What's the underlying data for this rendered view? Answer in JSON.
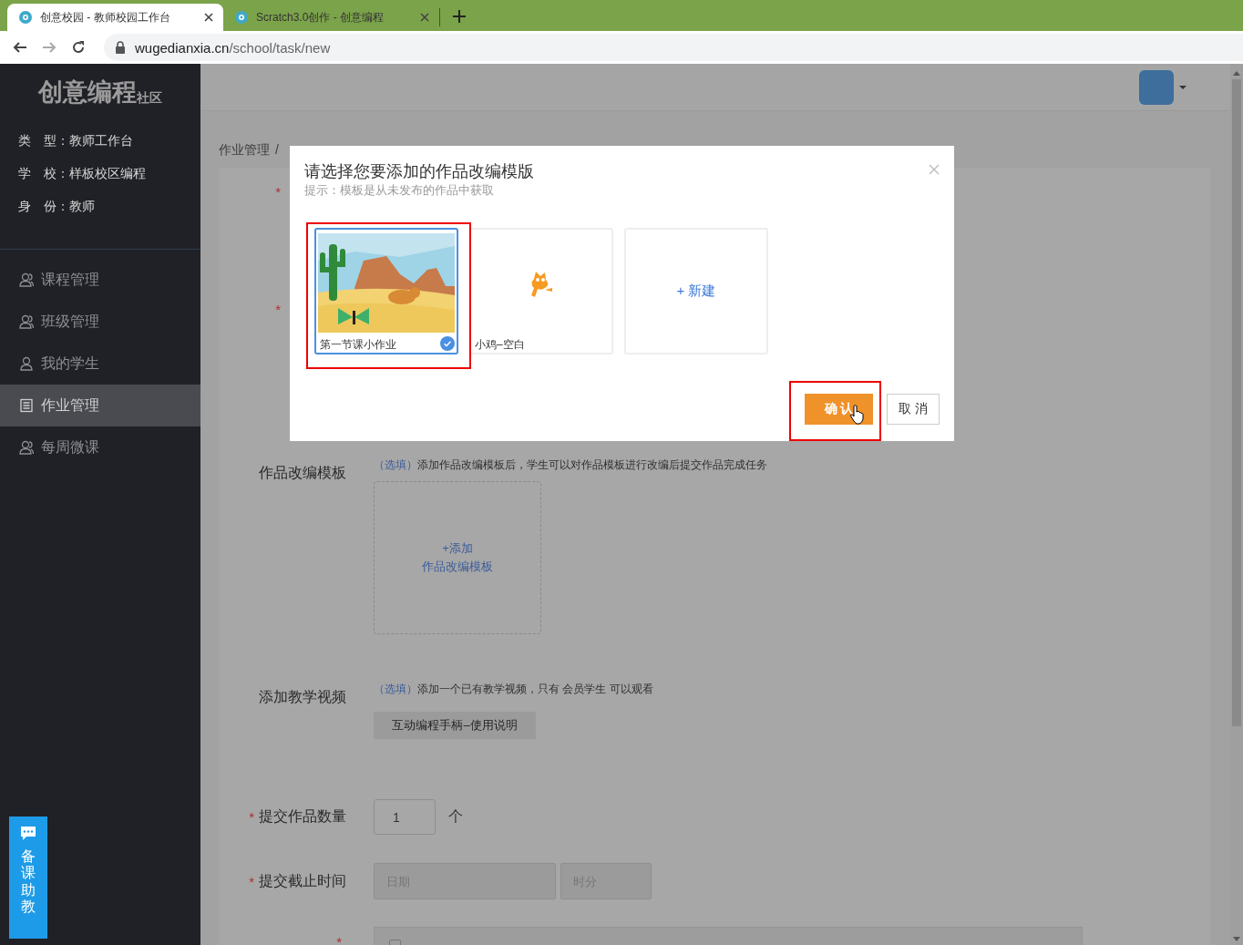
{
  "browser": {
    "tabs": [
      {
        "title": "创意校园 - 教师校园工作台",
        "selected": true
      },
      {
        "title": "Scratch3.0创作 - 创意编程",
        "selected": false
      }
    ],
    "url": {
      "host": "wugedianxia.cn",
      "path": "/school/task/new"
    }
  },
  "sidebar": {
    "logo": {
      "main": "创意编程",
      "sub": "社区"
    },
    "info": [
      {
        "label": "类　型：",
        "value": "教师工作台"
      },
      {
        "label": "学　校：",
        "value": "样板校区编程"
      },
      {
        "label": "身　份：",
        "value": "教师"
      }
    ],
    "menu": [
      {
        "label": "课程管理",
        "kind": "group",
        "selected": false
      },
      {
        "label": "班级管理",
        "kind": "group",
        "selected": false
      },
      {
        "label": "我的学生",
        "kind": "person",
        "selected": false
      },
      {
        "label": "作业管理",
        "kind": "form",
        "selected": true
      },
      {
        "label": "每周微课",
        "kind": "group",
        "selected": false
      }
    ]
  },
  "breadcrumb": {
    "parent": "作业管理",
    "separator": "/"
  },
  "form": {
    "hidden_rows": [
      {
        "required": true,
        "mark": "*"
      },
      {
        "required": true,
        "mark": "*"
      }
    ],
    "rows": [
      {
        "kind": "template",
        "required": false,
        "label": "作品改编模板",
        "optional_tag": "（选填）",
        "hint": "添加作品改编模板后，学生可以对作品模板进行改编后提交作品完成任务",
        "add_lines": [
          "+添加",
          "作品改编模板"
        ]
      },
      {
        "kind": "video",
        "required": false,
        "label": "添加教学视频",
        "optional_tag": "（选填）",
        "hint": "添加一个已有教学视频，只有 会员学生 可以观看",
        "button": "互动编程手柄–使用说明"
      },
      {
        "kind": "count",
        "required": true,
        "label": "提交作品数量",
        "value": "1",
        "unit": "个"
      },
      {
        "kind": "deadline",
        "required": true,
        "label": "提交截止时间",
        "date_placeholder": "日期",
        "time_placeholder": "时分"
      },
      {
        "kind": "classes",
        "required": true,
        "all_checked": false
      }
    ]
  },
  "modal": {
    "title": "请选择您要添加的作品改编模版",
    "hint": "提示：模板是从未发布的作品中获取",
    "templates": [
      {
        "name": "第一节课小作业",
        "kind": "desert",
        "selected": true
      },
      {
        "name": "小鸡–空白",
        "kind": "cat",
        "selected": false
      }
    ],
    "new_card": "+ 新建",
    "buttons": [
      {
        "label": "确 认",
        "kind": "primary"
      },
      {
        "label": "取 消",
        "kind": "default"
      }
    ]
  },
  "helper": {
    "label": "备课助教"
  }
}
